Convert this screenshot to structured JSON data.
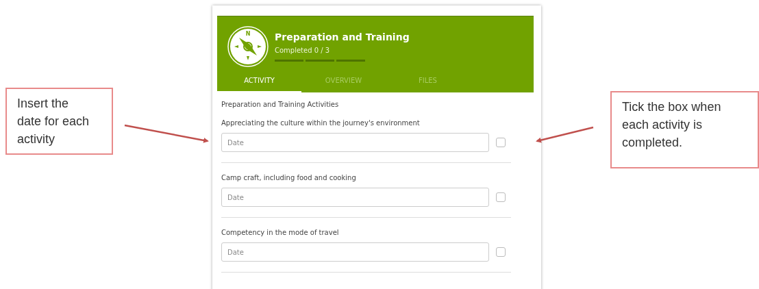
{
  "left_callout": {
    "text": "Insert the date for each activity"
  },
  "right_callout": {
    "text": "Tick the box when each activity is completed."
  },
  "header": {
    "compass_letter": "N",
    "title": "Preparation and Training",
    "progress_text": "Completed 0 / 3",
    "progress_segments": [
      {
        "done": false
      },
      {
        "done": false
      },
      {
        "done": false
      }
    ]
  },
  "tabs": [
    {
      "label": "ACTIVITY",
      "selected": true
    },
    {
      "label": "OVERVIEW",
      "selected": false
    },
    {
      "label": "FILES",
      "selected": false
    }
  ],
  "section_title": "Preparation and Training Activities",
  "activities": [
    {
      "label": "Appreciating the culture within the journey's environment",
      "placeholder": "Date",
      "checked": false
    },
    {
      "label": "Camp craft, including food and cooking",
      "placeholder": "Date",
      "checked": false
    },
    {
      "label": "Competency in the mode of travel",
      "placeholder": "Date",
      "checked": false
    }
  ]
}
